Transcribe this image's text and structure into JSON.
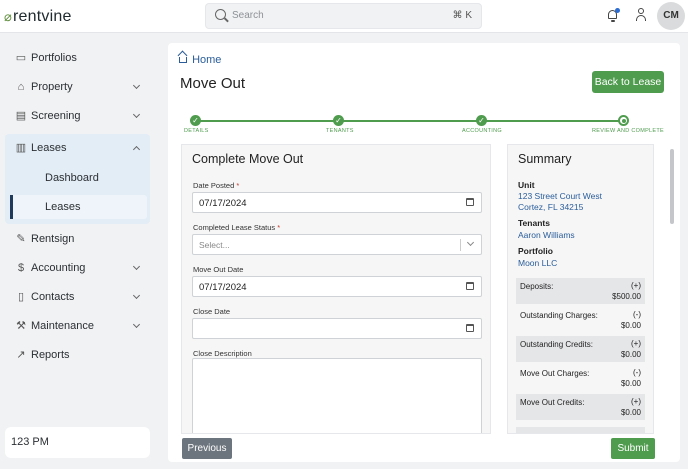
{
  "header": {
    "logo_text": "rentvine",
    "search_placeholder": "Search",
    "search_shortcut": "⌘ K",
    "avatar_initials": "CM"
  },
  "sidebar": {
    "items": [
      {
        "label": "Portfolios",
        "icon": "folder-icon"
      },
      {
        "label": "Property",
        "icon": "house-icon"
      },
      {
        "label": "Screening",
        "icon": "screening-icon"
      },
      {
        "label": "Leases",
        "icon": "clipboard-icon"
      },
      {
        "label": "Rentsign",
        "icon": "signature-icon"
      },
      {
        "label": "Accounting",
        "icon": "dollar-icon"
      },
      {
        "label": "Contacts",
        "icon": "book-icon"
      },
      {
        "label": "Maintenance",
        "icon": "wrench-icon"
      },
      {
        "label": "Reports",
        "icon": "chart-icon"
      }
    ],
    "leases_sub": [
      {
        "label": "Dashboard"
      },
      {
        "label": "Leases"
      }
    ],
    "time": "123 PM"
  },
  "main": {
    "breadcrumb": "Home",
    "title": "Move Out",
    "back_button": "Back to Lease",
    "steps": [
      {
        "label": "DETAILS"
      },
      {
        "label": "TENANTS"
      },
      {
        "label": "ACCOUNTING"
      },
      {
        "label": "REVIEW AND COMPLETE"
      }
    ],
    "form": {
      "title": "Complete Move Out",
      "date_posted_label": "Date Posted",
      "date_posted_value": "07/17/2024",
      "lease_status_label": "Completed Lease Status",
      "lease_status_placeholder": "Select...",
      "move_out_date_label": "Move Out Date",
      "move_out_date_value": "07/17/2024",
      "close_date_label": "Close Date",
      "close_date_value": "",
      "close_description_label": "Close Description",
      "required_mark": "*"
    },
    "summary": {
      "title": "Summary",
      "unit_label": "Unit",
      "unit_line1": "123 Street Court West",
      "unit_line2": "Cortez, FL 34215",
      "tenants_label": "Tenants",
      "tenant": "Aaron Williams",
      "portfolio_label": "Portfolio",
      "portfolio": "Moon LLC",
      "rows": [
        {
          "label": "Deposits:",
          "sign": "(+)",
          "value": "$500.00"
        },
        {
          "label": "Outstanding Charges:",
          "sign": "(-)",
          "value": "$0.00"
        },
        {
          "label": "Outstanding Credits:",
          "sign": "(+)",
          "value": "$0.00"
        },
        {
          "label": "Move Out Charges:",
          "sign": "(-)",
          "value": "$0.00"
        },
        {
          "label": "Move Out Credits:",
          "sign": "(+)",
          "value": "$0.00"
        }
      ]
    },
    "previous_button": "Previous",
    "submit_button": "Submit"
  },
  "colors": {
    "accent_green": "#4f9c4f",
    "link_blue": "#2a5d9a",
    "active_nav_bg": "#e3edf6"
  }
}
